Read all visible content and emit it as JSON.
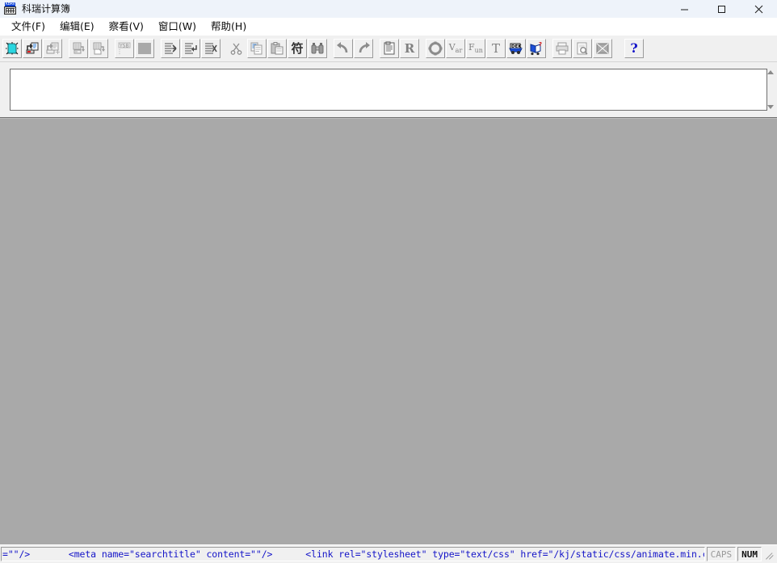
{
  "window": {
    "title": "科瑞计算簿",
    "icon": "calculator-keyboard-icon",
    "minimize_label": "minimize",
    "maximize_label": "maximize",
    "close_label": "close"
  },
  "menubar": {
    "items": [
      {
        "label": "文件(F)",
        "name": "menu-file"
      },
      {
        "label": "编辑(E)",
        "name": "menu-edit"
      },
      {
        "label": "察看(V)",
        "name": "menu-view"
      },
      {
        "label": "窗口(W)",
        "name": "menu-window"
      },
      {
        "label": "帮助(H)",
        "name": "menu-help"
      }
    ]
  },
  "toolbar": {
    "groups": [
      {
        "buttons": [
          {
            "name": "new-document-button",
            "icon": "new-document-icon",
            "enabled": true
          },
          {
            "name": "open-document-button",
            "icon": "open-folder-icon",
            "enabled": true
          },
          {
            "name": "open-add-button",
            "icon": "open-add-icon",
            "enabled": false
          }
        ]
      },
      {
        "buttons": [
          {
            "name": "save-button",
            "icon": "save-disk-icon",
            "enabled": false
          },
          {
            "name": "save-as-button",
            "icon": "save-as-icon",
            "enabled": false
          }
        ]
      },
      {
        "buttons": [
          {
            "name": "ysb-button",
            "icon": "ysb-label-icon",
            "enabled": false
          },
          {
            "name": "blank-page-button",
            "icon": "blank-page-icon",
            "enabled": false
          }
        ]
      },
      {
        "buttons": [
          {
            "name": "insert-row-before-button",
            "icon": "insert-line-left-icon",
            "enabled": false
          },
          {
            "name": "insert-row-after-button",
            "icon": "insert-line-return-icon",
            "enabled": false
          },
          {
            "name": "delete-row-button",
            "icon": "delete-line-icon",
            "enabled": false
          }
        ]
      },
      {
        "buttons": [
          {
            "name": "cut-button",
            "icon": "scissors-icon",
            "enabled": false
          },
          {
            "name": "copy-button",
            "icon": "copy-pages-icon",
            "enabled": false
          },
          {
            "name": "paste-button",
            "icon": "clipboard-paste-icon",
            "enabled": false
          },
          {
            "name": "special-char-button",
            "icon": "chinese-char-icon",
            "enabled": true
          },
          {
            "name": "find-button",
            "icon": "binoculars-icon",
            "enabled": false
          }
        ]
      },
      {
        "buttons": [
          {
            "name": "undo-button",
            "icon": "undo-arrow-icon",
            "enabled": false
          },
          {
            "name": "redo-button",
            "icon": "redo-arrow-icon",
            "enabled": false
          }
        ]
      },
      {
        "buttons": [
          {
            "name": "properties-button",
            "icon": "properties-sheet-icon",
            "enabled": false
          },
          {
            "name": "recalculate-button",
            "icon": "letter-r-icon",
            "enabled": false
          }
        ]
      },
      {
        "buttons": [
          {
            "name": "constants-button",
            "icon": "gear-ring-icon",
            "enabled": false
          },
          {
            "name": "variables-button",
            "icon": "var-icon",
            "enabled": false
          },
          {
            "name": "functions-button",
            "icon": "fun-icon",
            "enabled": false
          },
          {
            "name": "text-button",
            "icon": "letter-t-icon",
            "enabled": false
          },
          {
            "name": "dek-button",
            "icon": "dek-truck-icon",
            "enabled": true
          },
          {
            "name": "help-book-button",
            "icon": "open-book-help-icon",
            "enabled": true
          }
        ]
      },
      {
        "buttons": [
          {
            "name": "print-button",
            "icon": "printer-icon",
            "enabled": false
          },
          {
            "name": "print-preview-button",
            "icon": "print-preview-icon",
            "enabled": false
          },
          {
            "name": "image-button",
            "icon": "picture-icon",
            "enabled": false
          }
        ]
      },
      {
        "buttons": [
          {
            "name": "about-help-button",
            "icon": "question-mark-icon",
            "enabled": true
          }
        ]
      }
    ]
  },
  "editor": {
    "value": "",
    "scroll_up_label": "scroll up",
    "scroll_down_label": "scroll down"
  },
  "statusbar": {
    "message": "=\"\"/>       <meta name=\"searchtitle\" content=\"\"/>      <link rel=\"stylesheet\" type=\"text/css\" href=\"/kj/static/css/animate.min.css\"/>      <link rel=\"",
    "caps": "CAPS",
    "num": "NUM"
  },
  "colors": {
    "titlebar_bg": "#eef3fa",
    "toolbar_bg": "#f0f0f0",
    "client_bg": "#a9a9a9",
    "status_text": "#1414c8",
    "accent_cyan": "#29d6e0",
    "accent_blue": "#0b3fd4"
  }
}
